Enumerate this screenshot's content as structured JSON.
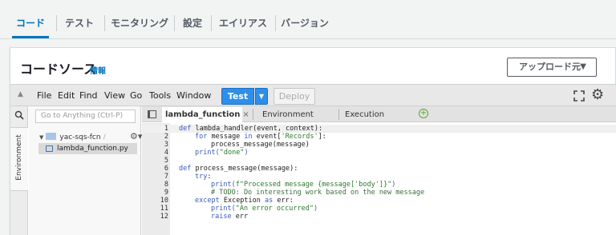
{
  "top_tabs": [
    {
      "label": "コード",
      "active": true
    },
    {
      "label": "テスト",
      "active": false
    },
    {
      "label": "モニタリング",
      "active": false
    },
    {
      "label": "設定",
      "active": false
    },
    {
      "label": "エイリアス",
      "active": false
    },
    {
      "label": "バージョン",
      "active": false
    }
  ],
  "card": {
    "title": "コードソース",
    "info_link": "情報",
    "upload_button": "アップロード元",
    "upload_caret": "▼"
  },
  "menu": {
    "items": [
      "File",
      "Edit",
      "Find",
      "View",
      "Go",
      "Tools",
      "Window"
    ],
    "test_button": "Test",
    "deploy_button": "Deploy"
  },
  "sidebar": {
    "environment_label": "Environment",
    "goto_placeholder": "Go to Anything (Ctrl-P)",
    "folder": "yac-sqs-fcn",
    "folder_suffix": "/",
    "file": "lambda_function.py"
  },
  "editor_tabs": [
    {
      "label": "lambda_function",
      "close": "×",
      "active": true
    },
    {
      "label": "Environment Var",
      "close": "×",
      "active": false
    },
    {
      "label": "Execution results",
      "close": "×",
      "active": false
    }
  ],
  "add_tab": "+",
  "code_lines": [
    {
      "n": "1"
    },
    {
      "n": "2"
    },
    {
      "n": "3"
    },
    {
      "n": "4"
    },
    {
      "n": "5"
    },
    {
      "n": "6"
    },
    {
      "n": "7"
    },
    {
      "n": "8"
    },
    {
      "n": "9"
    },
    {
      "n": "10"
    },
    {
      "n": "11"
    },
    {
      "n": "12"
    }
  ],
  "code": {
    "l1_kw": "def",
    "l1_rest": " lambda_handler(event, context):",
    "l2_kw1": "for",
    "l2_mid": " message ",
    "l2_kw2": "in",
    "l2_pre": " event[",
    "l2_str": "'Records'",
    "l2_end": "]:",
    "l3": "process_message(message)",
    "l4_fn": "print(",
    "l4_str": "\"done\"",
    "l4_end": ")",
    "l6_kw": "def",
    "l6_rest": " process_message(message):",
    "l7_kw": "try",
    "l7_end": ":",
    "l8_fn": "print(",
    "l8_str": "f\"Processed message {message['body']}\"",
    "l8_end": ")",
    "l9": "# TODO: Do interesting work based on the new message",
    "l10_kw1": "except",
    "l10_mid": " Exception ",
    "l10_kw2": "as",
    "l10_end": " err:",
    "l11_fn": "print(",
    "l11_str": "\"An error occurred\"",
    "l11_end": ")",
    "l12_kw": "raise",
    "l12_rest": " err"
  },
  "colors": {
    "accent": "#0073bb",
    "test_button": "#2d8fe8"
  }
}
